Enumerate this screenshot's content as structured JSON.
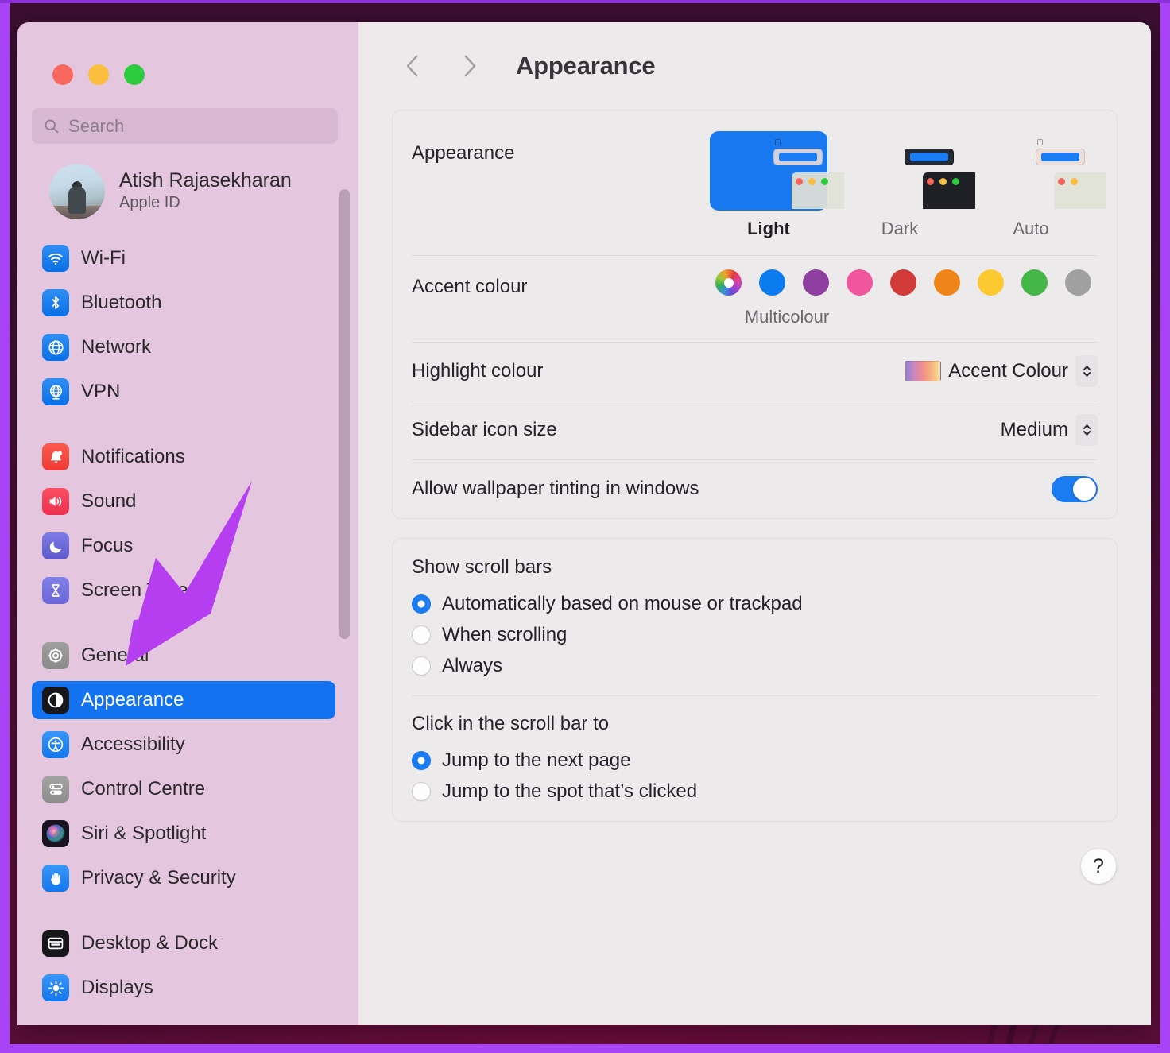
{
  "window": {
    "traffic_lights": [
      "close",
      "minimise",
      "zoom"
    ],
    "accent_hex": "#1272ef"
  },
  "sidebar": {
    "search": {
      "placeholder": "Search",
      "value": ""
    },
    "account": {
      "name": "Atish Rajasekharan",
      "subtitle": "Apple ID"
    },
    "groups": [
      {
        "items": [
          {
            "label": "Wi-Fi",
            "icon": "wifi-icon"
          },
          {
            "label": "Bluetooth",
            "icon": "bluetooth-icon"
          },
          {
            "label": "Network",
            "icon": "globe-icon"
          },
          {
            "label": "VPN",
            "icon": "vpn-globe-icon"
          }
        ]
      },
      {
        "items": [
          {
            "label": "Notifications",
            "icon": "bell-icon"
          },
          {
            "label": "Sound",
            "icon": "speaker-icon"
          },
          {
            "label": "Focus",
            "icon": "moon-icon"
          },
          {
            "label": "Screen Time",
            "icon": "hourglass-icon"
          }
        ]
      },
      {
        "items": [
          {
            "label": "General",
            "icon": "gear-icon"
          },
          {
            "label": "Appearance",
            "icon": "appearance-icon",
            "selected": true
          },
          {
            "label": "Accessibility",
            "icon": "accessibility-icon"
          },
          {
            "label": "Control Centre",
            "icon": "control-centre-icon"
          },
          {
            "label": "Siri & Spotlight",
            "icon": "siri-icon"
          },
          {
            "label": "Privacy & Security",
            "icon": "hand-icon"
          }
        ]
      },
      {
        "items": [
          {
            "label": "Desktop & Dock",
            "icon": "desktop-dock-icon"
          },
          {
            "label": "Displays",
            "icon": "brightness-icon"
          }
        ]
      }
    ]
  },
  "header": {
    "back_label": "Back",
    "forward_label": "Forward",
    "title": "Appearance"
  },
  "main": {
    "appearance": {
      "label": "Appearance",
      "options": [
        {
          "name": "Light",
          "selected": true
        },
        {
          "name": "Dark",
          "selected": false
        },
        {
          "name": "Auto",
          "selected": false
        }
      ]
    },
    "accent": {
      "label": "Accent colour",
      "selected_name": "Multicolour",
      "swatches": [
        {
          "name": "Multicolour",
          "hex": "multi",
          "selected": true
        },
        {
          "name": "Blue",
          "hex": "#0b7cf0"
        },
        {
          "name": "Purple",
          "hex": "#8e3fa0"
        },
        {
          "name": "Pink",
          "hex": "#f0559e"
        },
        {
          "name": "Red",
          "hex": "#d23b37"
        },
        {
          "name": "Orange",
          "hex": "#ef8418"
        },
        {
          "name": "Yellow",
          "hex": "#fdc930"
        },
        {
          "name": "Green",
          "hex": "#45b648"
        },
        {
          "name": "Graphite",
          "hex": "#a0a0a0"
        }
      ]
    },
    "highlight": {
      "label": "Highlight colour",
      "value": "Accent Colour"
    },
    "sidebar_icon_size": {
      "label": "Sidebar icon size",
      "value": "Medium"
    },
    "wallpaper_tinting": {
      "label": "Allow wallpaper tinting in windows",
      "enabled": true
    },
    "show_scroll_bars": {
      "title": "Show scroll bars",
      "options": [
        {
          "label": "Automatically based on mouse or trackpad",
          "selected": true
        },
        {
          "label": "When scrolling",
          "selected": false
        },
        {
          "label": "Always",
          "selected": false
        }
      ]
    },
    "click_scroll_bar": {
      "title": "Click in the scroll bar to",
      "options": [
        {
          "label": "Jump to the next page",
          "selected": true
        },
        {
          "label": "Jump to the spot that’s clicked",
          "selected": false
        }
      ]
    },
    "help_label": "?"
  },
  "annotation": {
    "arrow_colour": "#b43ef0"
  }
}
